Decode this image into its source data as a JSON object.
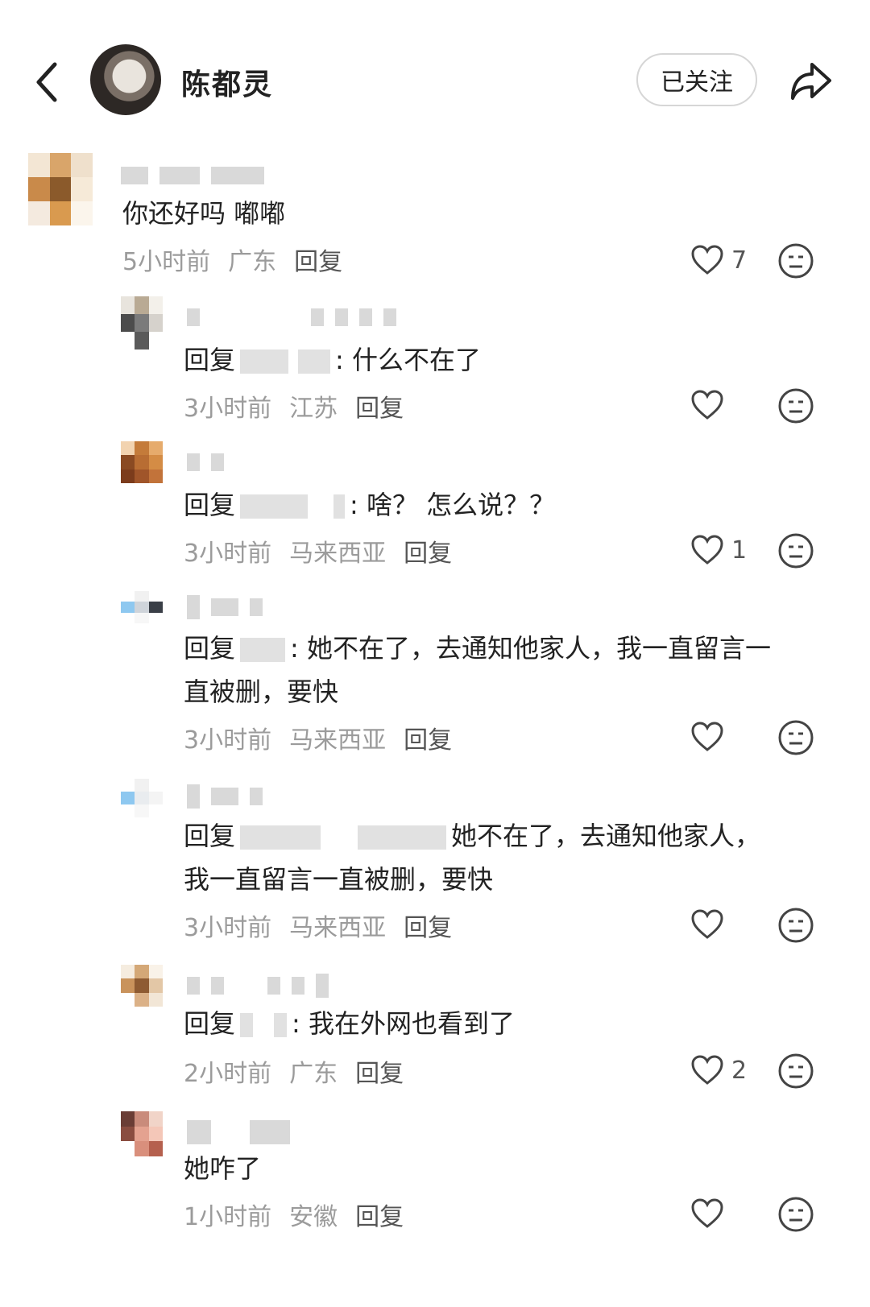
{
  "header": {
    "title": "陈都灵",
    "follow_label": "已关注"
  },
  "comments": [
    {
      "text": "你还好吗 嘟嘟",
      "time": "5小时前",
      "location": "广东",
      "reply_label": "回复",
      "likes": "7"
    },
    {
      "prefix": "回复",
      "text": ": 什么不在了",
      "time": "3小时前",
      "location": "江苏",
      "reply_label": "回复",
      "likes": ""
    },
    {
      "prefix": "回复",
      "text": ": 啥？ 怎么说？？",
      "time": "3小时前",
      "location": "马来西亚",
      "reply_label": "回复",
      "likes": "1"
    },
    {
      "prefix": "回复",
      "text": ": 她不在了，去通知他家人，我一直留言一",
      "text2": "直被删，要快",
      "time": "3小时前",
      "location": "马来西亚",
      "reply_label": "回复",
      "likes": ""
    },
    {
      "prefix": "回复",
      "text": "她不在了，去通知他家人，",
      "text2": "我一直留言一直被删，要快",
      "time": "3小时前",
      "location": "马来西亚",
      "reply_label": "回复",
      "likes": ""
    },
    {
      "prefix": "回复",
      "text": ": 我在外网也看到了",
      "time": "2小时前",
      "location": "广东",
      "reply_label": "回复",
      "likes": "2"
    },
    {
      "text": "她咋了",
      "time": "1小时前",
      "location": "安徽",
      "reply_label": "回复",
      "likes": ""
    }
  ]
}
